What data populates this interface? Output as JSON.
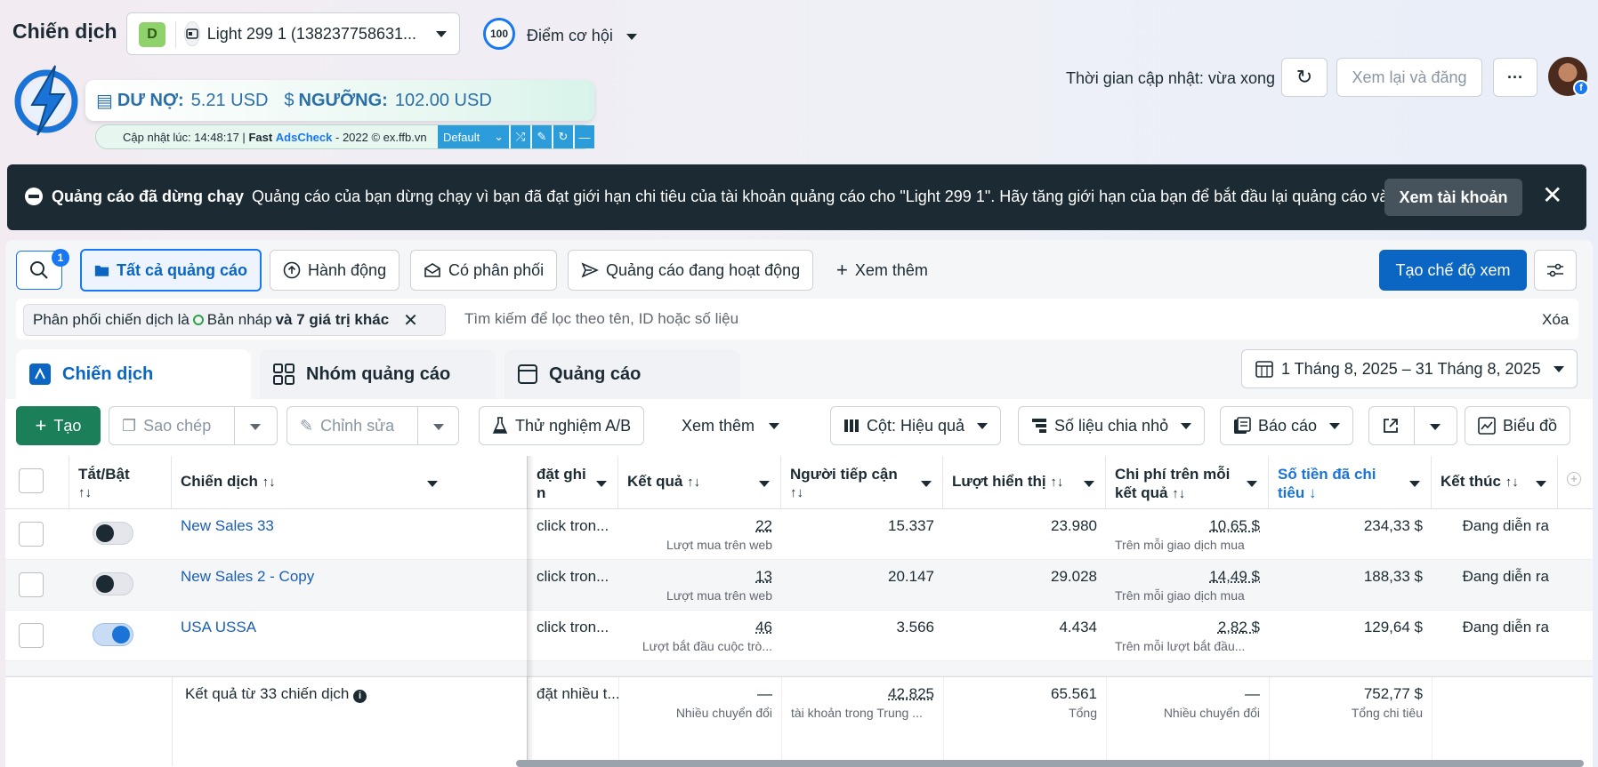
{
  "header": {
    "title": "Chiến dịch",
    "account_badge": "D",
    "account_name": "Light 299 1 (138237758631...",
    "opportunity_score": "100",
    "opportunity_label": "Điểm cơ hội",
    "update_time": "Thời gian cập nhật: vừa xong",
    "review_button": "Xem lại và đăng"
  },
  "extension": {
    "debt_label": "DƯ NỢ:",
    "debt_value": "5.21 USD",
    "threshold_label": "NGƯỠNG:",
    "threshold_value": "102.00 USD",
    "update_text": "Cập nhật lúc: 14:48:17 |",
    "brand_fast": "Fast",
    "brand_name": "AdsCheck",
    "copyright": "- 2022 © ex.ffb.vn",
    "profile_select": "Default"
  },
  "alert": {
    "title": "Quảng cáo đã dừng chạy",
    "message": "Quảng cáo của bạn dừng chạy vì bạn đã đạt giới hạn chi tiêu của tài khoản quảng cáo cho \"Light 299 1\". Hãy tăng giới hạn của bạn để bắt đầu lại quảng cáo và...",
    "button": "Xem tài khoản"
  },
  "filters": {
    "search_count": "1",
    "all_ads": "Tất cả quảng cáo",
    "actions": "Hành động",
    "delivery": "Có phân phối",
    "active_ads": "Quảng cáo đang hoạt động",
    "see_more": "Xem thêm",
    "create_view": "Tạo chế độ xem",
    "chip_prefix": "Phân phối chiến dịch là",
    "chip_value": "Bản nháp",
    "chip_suffix": "và 7 giá trị khác",
    "search_placeholder": "Tìm kiếm để lọc theo tên, ID hoặc số liệu",
    "clear": "Xóa"
  },
  "level_tabs": {
    "campaign": "Chiến dịch",
    "adset": "Nhóm quảng cáo",
    "ad": "Quảng cáo"
  },
  "date_range": "1 Tháng 8, 2025 – 31 Tháng 8, 2025",
  "toolbar": {
    "create": "Tạo",
    "copy": "Sao chép",
    "edit": "Chỉnh sửa",
    "ab_test": "Thử nghiệm A/B",
    "see_more": "Xem thêm",
    "columns": "Cột: Hiệu quả",
    "breakdown": "Số liệu chia nhỏ",
    "reports": "Báo cáo",
    "chart": "Biểu đồ"
  },
  "table": {
    "headers": {
      "toggle": "Tắt/Bật",
      "campaign": "Chiến dịch",
      "attribution_line1": "đặt ghi",
      "attribution_line2": "n",
      "results": "Kết quả",
      "reach_line1": "Người tiếp cận",
      "impressions": "Lượt hiển thị",
      "cpr_line1": "Chi phí trên mỗi",
      "cpr_line2": "kết quả",
      "spent_line1": "Số tiền đã chi",
      "spent_line2": "tiêu",
      "ends": "Kết thúc",
      "sort_glyph": "↑↓",
      "sort_down": "↓"
    },
    "rows": [
      {
        "name": "New Sales 33",
        "toggle_on": false,
        "attribution": "click tron...",
        "result": "22",
        "result_type": "Lượt mua trên web",
        "reach": "15.337",
        "impressions": "23.980",
        "cpr": "10,65 $",
        "cpr_type": "Trên mỗi giao dịch mua",
        "spent": "234,33 $",
        "ends": "Đang diễn ra"
      },
      {
        "name": "New Sales 2 - Copy",
        "toggle_on": false,
        "attribution": "click tron...",
        "result": "13",
        "result_type": "Lượt mua trên web",
        "reach": "20.147",
        "impressions": "29.028",
        "cpr": "14,49 $",
        "cpr_type": "Trên mỗi giao dịch mua",
        "spent": "188,33 $",
        "ends": "Đang diễn ra"
      },
      {
        "name": "USA USSA",
        "toggle_on": true,
        "attribution": "click tron...",
        "result": "46",
        "result_type": "Lượt bắt đầu cuộc trò...",
        "reach": "3.566",
        "impressions": "4.434",
        "cpr": "2,82 $",
        "cpr_type": "Trên mỗi lượt bắt đầu...",
        "spent": "129,64 $",
        "ends": "Đang diễn ra"
      }
    ],
    "summary": {
      "label": "Kết quả từ 33 chiến dịch",
      "attribution": "đặt nhiều t...",
      "result": "—",
      "result_sub": "Nhiều chuyển đổi",
      "reach": "42.825",
      "reach_sub": "tài khoản trong Trung ...",
      "impressions": "65.561",
      "impressions_sub": "Tổng",
      "cpr": "—",
      "cpr_sub": "Nhiều chuyển đổi",
      "spent": "752,77 $",
      "spent_sub": "Tổng chi tiêu"
    }
  }
}
